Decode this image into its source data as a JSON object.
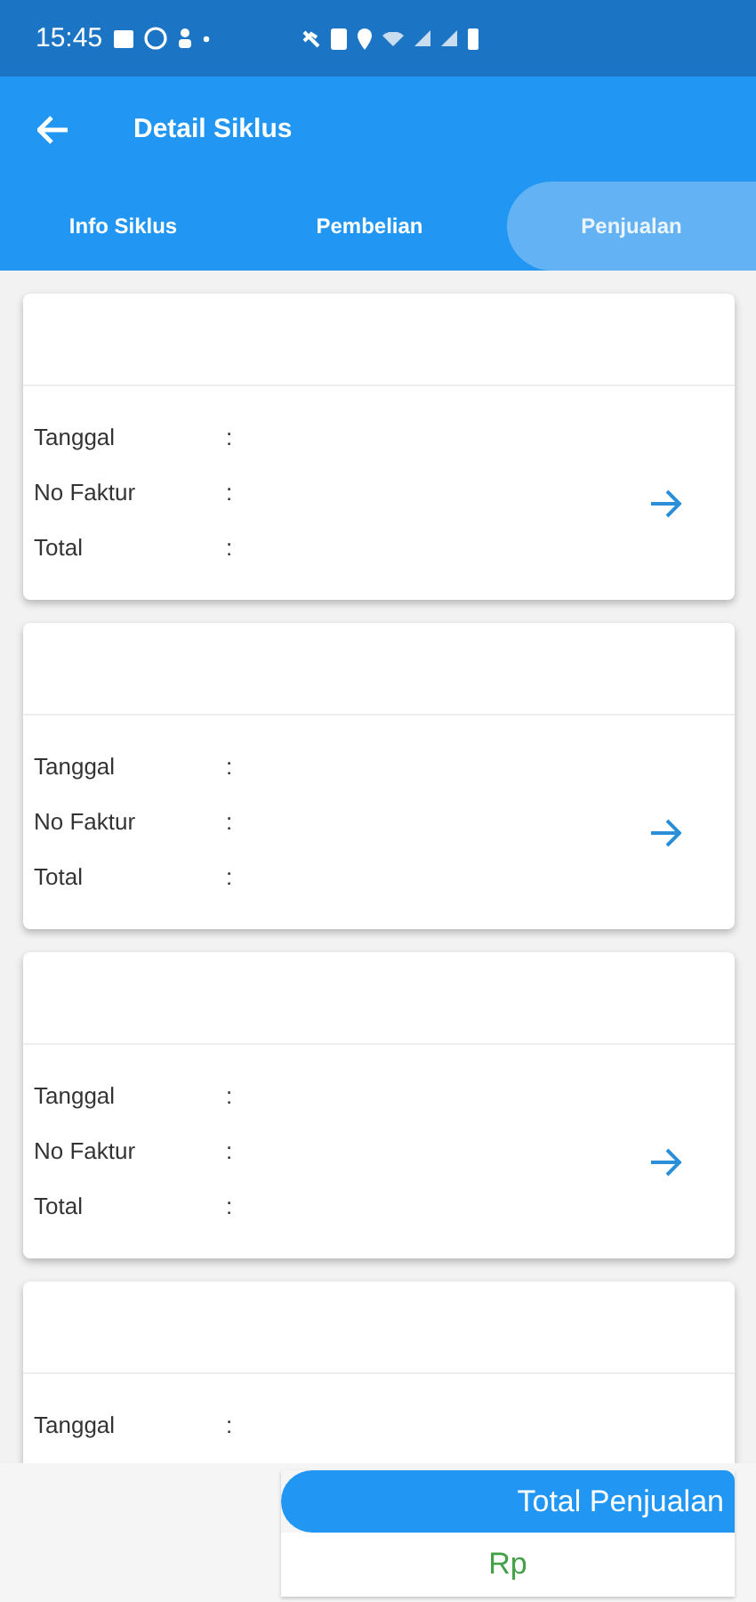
{
  "status_bar": {
    "time": "15:45"
  },
  "app_bar": {
    "title": "Detail Siklus"
  },
  "tabs": [
    {
      "label": "Info Siklus",
      "selected": false
    },
    {
      "label": "Pembelian",
      "selected": false
    },
    {
      "label": "Penjualan",
      "selected": true
    }
  ],
  "cards": [
    {
      "fields": [
        {
          "label": "Tanggal",
          "separator": ":"
        },
        {
          "label": "No Faktur",
          "separator": ":"
        },
        {
          "label": "Total",
          "separator": ":"
        }
      ],
      "arrow": true
    },
    {
      "fields": [
        {
          "label": "Tanggal",
          "separator": ":"
        },
        {
          "label": "No Faktur",
          "separator": ":"
        },
        {
          "label": "Total",
          "separator": ":"
        }
      ],
      "arrow": true
    },
    {
      "fields": [
        {
          "label": "Tanggal",
          "separator": ":"
        },
        {
          "label": "No Faktur",
          "separator": ":"
        },
        {
          "label": "Total",
          "separator": ":"
        }
      ],
      "arrow": true
    },
    {
      "fields": [
        {
          "label": "Tanggal",
          "separator": ":"
        }
      ],
      "arrow": false
    }
  ],
  "summary": {
    "title": "Total Penjualan",
    "value": "Rp"
  }
}
